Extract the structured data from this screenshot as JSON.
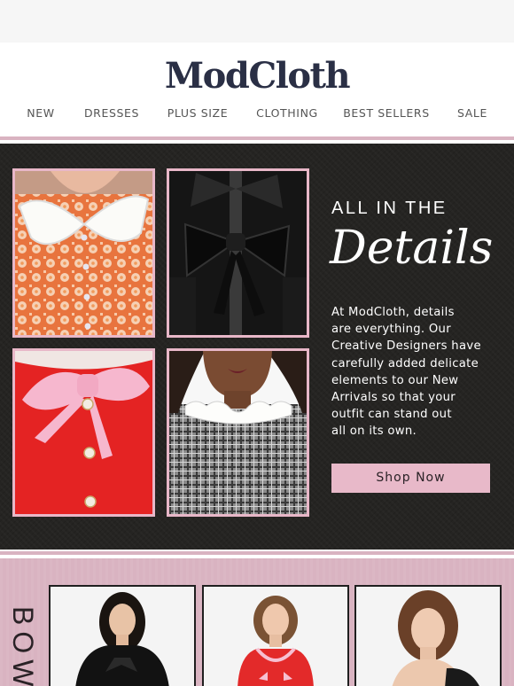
{
  "brand": {
    "logo_text": "ModCloth"
  },
  "nav": {
    "items": [
      {
        "label": "NEW"
      },
      {
        "label": "DRESSES"
      },
      {
        "label": "PLUS SIZE"
      },
      {
        "label": "CLOTHING"
      },
      {
        "label": "BEST SELLERS"
      },
      {
        "label": "SALE"
      }
    ]
  },
  "hero": {
    "kicker": "ALL IN THE",
    "headline": "Details",
    "body_lines": [
      "At ModCloth, details",
      "are everything. Our",
      "Creative Designers have",
      "carefully added delicate",
      "elements to our New",
      "Arrivals so that your",
      "outfit can stand out",
      "all on its own."
    ],
    "cta_label": "Shop Now",
    "photos": [
      {
        "name": "orange-daisy-collar-photo"
      },
      {
        "name": "black-velvet-bow-photo"
      },
      {
        "name": "red-pink-bow-photo"
      },
      {
        "name": "plaid-scallop-collar-photo"
      }
    ]
  },
  "section2": {
    "vertical_text": "BOWS"
  },
  "colors": {
    "accent_pink": "#e8b9c9",
    "band_pink": "#d9b3c1",
    "hero_bg": "#252422",
    "logo_navy": "#2a2f45"
  }
}
